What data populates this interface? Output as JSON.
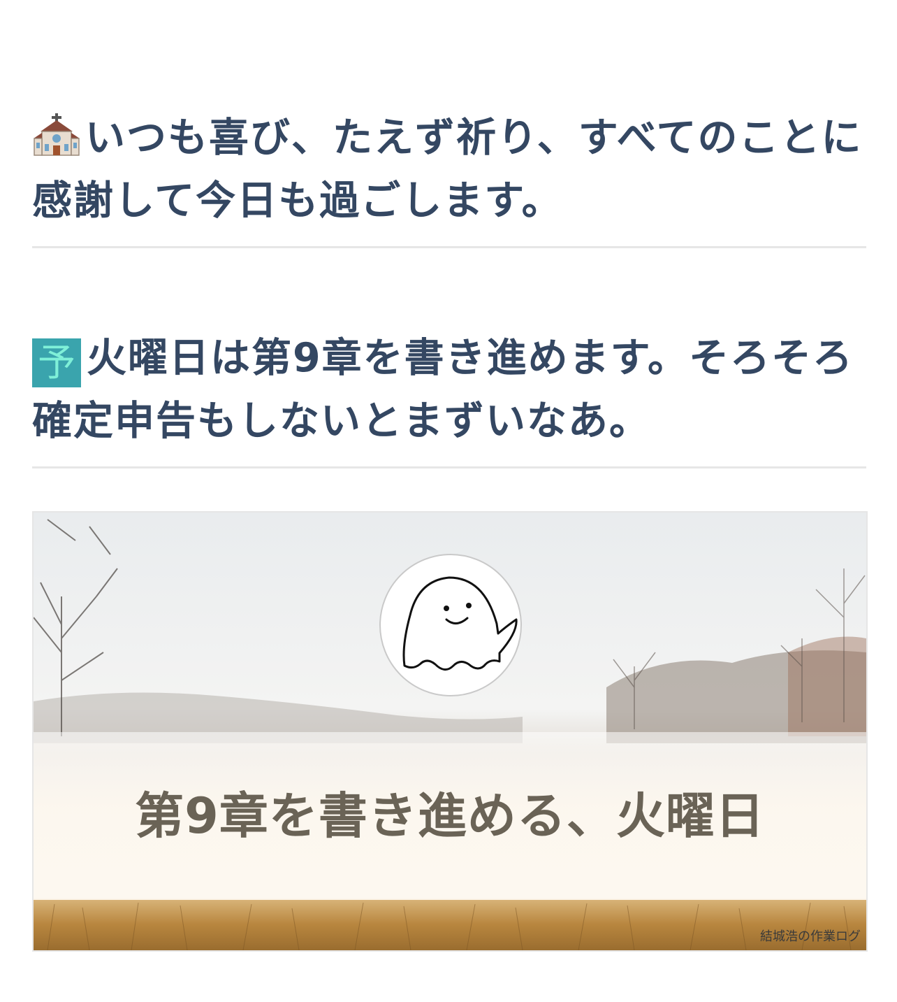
{
  "post": {
    "line1": "いつも喜び、たえず祈り、すべてのことに感謝して今日も過ごします。",
    "line1_icon": "church-icon",
    "line2_icon_label": "予",
    "line2": "火曜日は第9章を書き進めます。そろそろ確定申告もしないとまずいなあ。"
  },
  "card": {
    "title": "第9章を書き進める、火曜日",
    "watermark": "結城浩の作業ログ",
    "avatar_icon": "ghost-icon"
  },
  "colors": {
    "text": "#344762",
    "divider": "#e6e6e6",
    "yo_bg": "#3aa4ad",
    "card_title": "#6a6356"
  }
}
